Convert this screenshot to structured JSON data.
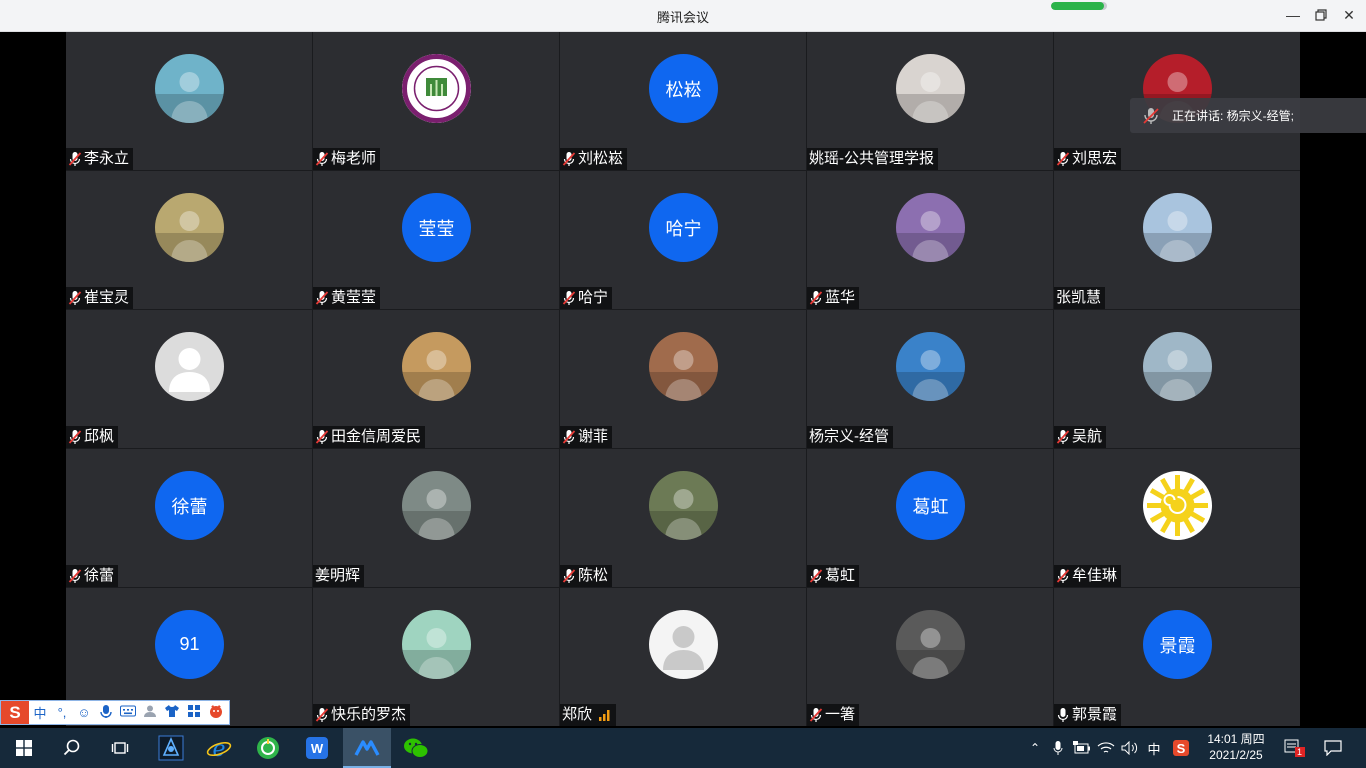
{
  "window": {
    "title": "腾讯会议",
    "network_quality": 0.95,
    "controls": [
      "minimize-icon",
      "restore-icon",
      "close-icon"
    ]
  },
  "speaking": {
    "text": "正在讲话: 杨宗义-经管;"
  },
  "participants": [
    {
      "name": "李永立",
      "mic": "muted",
      "avatar": "photo",
      "avatar_color": "#6fb3c9"
    },
    {
      "name": "梅老师",
      "mic": "muted",
      "avatar": "nankai-logo",
      "avatar_color": "#7a1f6e"
    },
    {
      "name": "刘松崧",
      "mic": "muted",
      "avatar": "text",
      "avatar_text": "松崧"
    },
    {
      "name": "姚瑶-公共管理学报",
      "mic": "none",
      "avatar": "photo",
      "avatar_color": "#d9d4d0"
    },
    {
      "name": "刘思宏",
      "mic": "muted",
      "avatar": "photo",
      "avatar_color": "#b51e2a"
    },
    {
      "name": "崔宝灵",
      "mic": "muted",
      "avatar": "photo",
      "avatar_color": "#b9a870"
    },
    {
      "name": "黄莹莹",
      "mic": "muted",
      "avatar": "text",
      "avatar_text": "莹莹"
    },
    {
      "name": "哈宁",
      "mic": "muted",
      "avatar": "text",
      "avatar_text": "哈宁"
    },
    {
      "name": "蓝华",
      "mic": "muted",
      "avatar": "photo",
      "avatar_color": "#8c6fb0"
    },
    {
      "name": "张凯慧",
      "mic": "none",
      "avatar": "photo",
      "avatar_color": "#a9c4de"
    },
    {
      "name": "邱枫",
      "mic": "muted",
      "avatar": "default-gray"
    },
    {
      "name": "田金信周爱民",
      "mic": "muted",
      "avatar": "photo",
      "avatar_color": "#c59a5f"
    },
    {
      "name": "谢菲",
      "mic": "muted",
      "avatar": "photo",
      "avatar_color": "#a06b4c"
    },
    {
      "name": "杨宗义-经管",
      "mic": "none",
      "avatar": "photo",
      "avatar_color": "#3a82c9"
    },
    {
      "name": "吴航",
      "mic": "muted",
      "avatar": "photo",
      "avatar_color": "#9fb7c7"
    },
    {
      "name": "徐蕾",
      "mic": "muted",
      "avatar": "text",
      "avatar_text": "徐蕾"
    },
    {
      "name": "姜明辉",
      "mic": "none",
      "avatar": "photo",
      "avatar_color": "#7e8a86"
    },
    {
      "name": "陈松",
      "mic": "muted",
      "avatar": "photo",
      "avatar_color": "#6c7a55"
    },
    {
      "name": "葛虹",
      "mic": "muted",
      "avatar": "text",
      "avatar_text": "葛虹"
    },
    {
      "name": "牟佳琳",
      "mic": "muted",
      "avatar": "sun",
      "avatar_color": "#f5d21b"
    },
    {
      "name": "",
      "mic": "none",
      "avatar": "text",
      "avatar_text": "91"
    },
    {
      "name": "快乐的罗杰",
      "mic": "muted",
      "avatar": "photo",
      "avatar_color": "#9fd4c0"
    },
    {
      "name": "郑欣",
      "mic": "none",
      "avatar": "default-white",
      "signal": "bars-orange"
    },
    {
      "name": "一箸",
      "mic": "muted",
      "avatar": "photo",
      "avatar_color": "#5a5a5a"
    },
    {
      "name": "郭景霞",
      "mic": "on",
      "avatar": "text",
      "avatar_text": "景霞"
    }
  ],
  "ime": {
    "logo": "S",
    "mode": "中",
    "punct": "°,"
  },
  "taskbar": {
    "tray_ime": "中",
    "time": "14:01 周四",
    "date": "2021/2/25",
    "notification_count": "1"
  }
}
